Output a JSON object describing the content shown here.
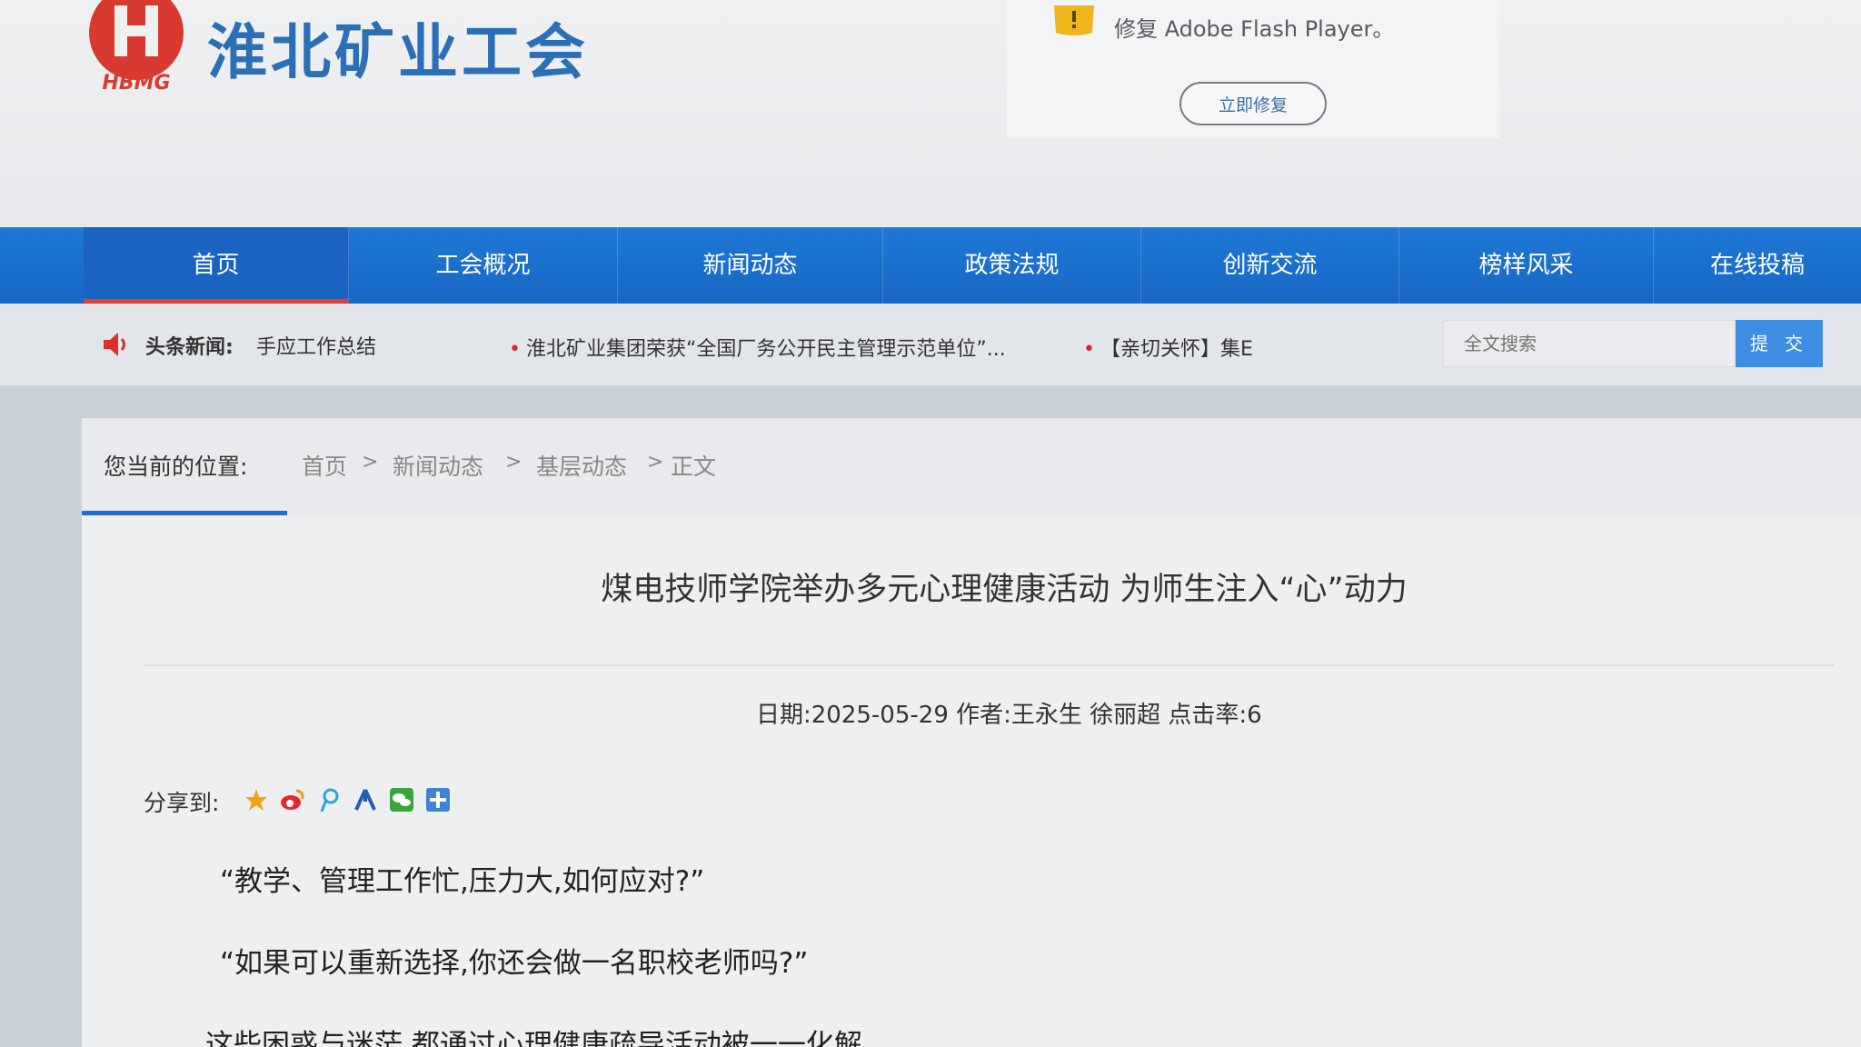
{
  "header": {
    "logo_text": "HBMG",
    "site_title": "淮北矿业工会",
    "flash_notice": "修复 Adobe Flash Player。",
    "flash_button": "立即修复"
  },
  "nav": {
    "items": [
      {
        "label": "首页",
        "active": true
      },
      {
        "label": "工会概况"
      },
      {
        "label": "新闻动态"
      },
      {
        "label": "政策法规"
      },
      {
        "label": "创新交流"
      },
      {
        "label": "榜样风采"
      },
      {
        "label": "在线投稿"
      }
    ]
  },
  "headlines": {
    "label": "头条新闻:",
    "first": "手应工作总结",
    "items": [
      "淮北矿业集团荣获“全国厂务公开民主管理示范单位”...",
      "【亲切关怀】集E"
    ]
  },
  "search": {
    "placeholder": "全文搜索",
    "button": "提 交"
  },
  "breadcrumb": {
    "label": "您当前的位置:",
    "items": [
      "首页",
      "新闻动态",
      "基层动态",
      "正文"
    ],
    "separator": ">"
  },
  "article": {
    "title": "煤电技师学院举办多元心理健康活动 为师生注入“心”动力",
    "meta": "日期:2025-05-29 作者:王永生 徐丽超 点击率:6",
    "share_label": "分享到:",
    "share_icons": [
      "favorite-icon",
      "weibo-icon",
      "tencent-weibo-icon",
      "renren-icon",
      "wechat-icon",
      "more-share-icon"
    ],
    "paragraphs": [
      "“教学、管理工作忙,压力大,如何应对?”",
      "“如果可以重新选择,你还会做一名职校老师吗?”",
      "这些困惑与迷茫,都通过心理健康疏导活动被一一化解。"
    ]
  },
  "colors": {
    "nav_blue": "#1f78d6",
    "active_underline": "#e23b2f",
    "brand_blue": "#2b6fb6",
    "logo_red": "#d83a30"
  }
}
